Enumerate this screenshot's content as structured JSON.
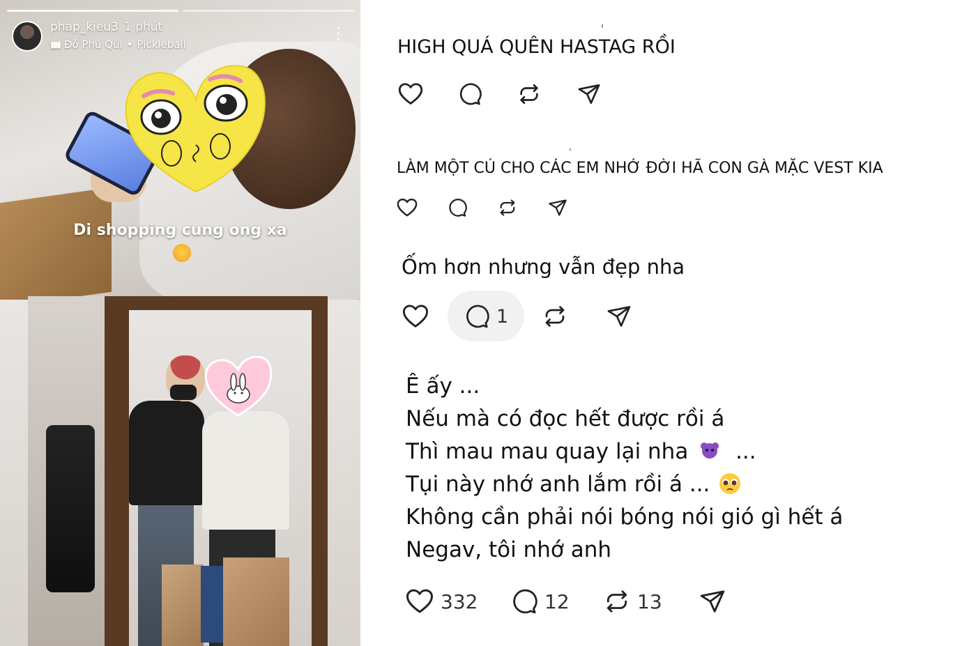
{
  "story": {
    "username": "phap_kieu3",
    "time": "1 phút",
    "music": "Đỗ Phú Qúi",
    "separator": "•",
    "music_tag": "Pickleball",
    "caption": "Di shopping cung ong xa",
    "progress_segments": 2
  },
  "posts": [
    {
      "text": "HIGH QUÁ QUÊN HASTAG RỒI"
    },
    {
      "text": "LÀM MỘT CÚ CHO CÁC EM NHỚ ĐỜI HÃ CON GÀ MẶC VEST KIA"
    },
    {
      "text": "Ốm hơn nhưng vẫn đẹp nha",
      "reply_count": "1"
    },
    {
      "lines": [
        "Ê ấy ...",
        "Nếu mà có đọc hết được rồi á",
        "Thì mau mau quay lại nha",
        "...",
        "Tụi này nhớ anh lắm rồi á ...",
        "Không cần phải nói bóng nói gió gì hết á",
        "Negav, tôi nhớ anh"
      ],
      "like_count": "332",
      "reply_count": "12",
      "repost_count": "13"
    }
  ],
  "icons": {
    "like": "heart-icon",
    "reply": "comment-icon",
    "repost": "repost-icon",
    "share": "send-icon"
  }
}
